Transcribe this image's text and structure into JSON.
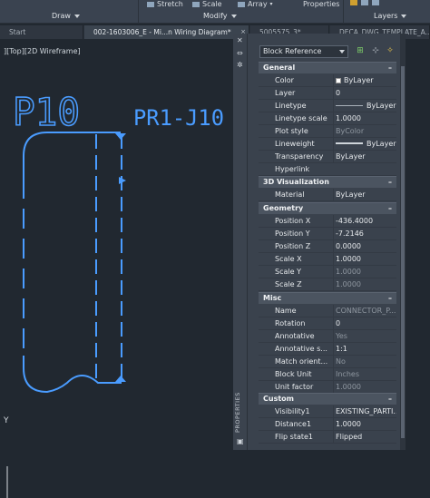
{
  "ribbon": {
    "commands": {
      "stretch": "Stretch",
      "scale": "Scale",
      "array": "Array",
      "properties": "Properties"
    },
    "panels": {
      "draw": "Draw",
      "modify": "Modify",
      "layers": "Layers"
    }
  },
  "tabs": [
    {
      "label": "Start"
    },
    {
      "label": "002-1603006_E - Mi...n Wiring Diagram*"
    },
    {
      "label": "5005575_3*"
    },
    {
      "label": "DECA_DWG_TEMPLATE_A..."
    }
  ],
  "viewport": {
    "label": "][Top][2D Wireframe]",
    "text_p10": "P10",
    "text_pr": "PR1-J10",
    "ucs_y": "Y"
  },
  "palette": {
    "title": "PROPERTIES",
    "selector": "Block Reference",
    "sections": {
      "general": "General",
      "viz3d": "3D Visualization",
      "geometry": "Geometry",
      "misc": "Misc",
      "custom": "Custom"
    },
    "collapse_symbol": "–",
    "rows": {
      "color": {
        "k": "Color",
        "v": "ByLayer"
      },
      "layer": {
        "k": "Layer",
        "v": "0"
      },
      "linetype": {
        "k": "Linetype",
        "v": "ByLayer"
      },
      "linetype_scale": {
        "k": "Linetype scale",
        "v": "1.0000"
      },
      "plot_style": {
        "k": "Plot style",
        "v": "ByColor"
      },
      "lineweight": {
        "k": "Lineweight",
        "v": "ByLayer"
      },
      "transparency": {
        "k": "Transparency",
        "v": "ByLayer"
      },
      "hyperlink": {
        "k": "Hyperlink",
        "v": ""
      },
      "material": {
        "k": "Material",
        "v": "ByLayer"
      },
      "pos_x": {
        "k": "Position X",
        "v": "-436.4000"
      },
      "pos_y": {
        "k": "Position Y",
        "v": "-7.2146"
      },
      "pos_z": {
        "k": "Position Z",
        "v": "0.0000"
      },
      "scale_x": {
        "k": "Scale X",
        "v": "1.0000"
      },
      "scale_y": {
        "k": "Scale Y",
        "v": "1.0000"
      },
      "scale_z": {
        "k": "Scale Z",
        "v": "1.0000"
      },
      "name": {
        "k": "Name",
        "v": "CONNECTOR_P..."
      },
      "rotation": {
        "k": "Rotation",
        "v": "0"
      },
      "annotative": {
        "k": "Annotative",
        "v": "Yes"
      },
      "annotative_scale": {
        "k": "Annotative s...",
        "v": "1:1"
      },
      "match_orient": {
        "k": "Match orient...",
        "v": "No"
      },
      "block_unit": {
        "k": "Block Unit",
        "v": "Inches"
      },
      "unit_factor": {
        "k": "Unit factor",
        "v": "1.0000"
      },
      "visibility1": {
        "k": "Visibility1",
        "v": "EXISTING_PARTI..."
      },
      "distance1": {
        "k": "Distance1",
        "v": "1.0000"
      },
      "flip_state1": {
        "k": "Flip state1",
        "v": "Flipped"
      }
    }
  },
  "colors": {
    "background": "#212830",
    "drawing_line": "#4a9cff",
    "palette_bg": "#3a424d",
    "section_bg": "#4b5460"
  },
  "icons": {
    "close": "close-icon",
    "settings": "gear-icon",
    "quick_select": "quick-select-icon",
    "select_objects": "select-objects-icon",
    "toggle_pickadd": "pickadd-icon"
  }
}
